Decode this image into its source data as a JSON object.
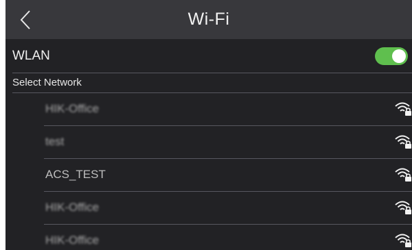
{
  "header": {
    "title": "Wi-Fi",
    "back_icon": "chevron-left-icon"
  },
  "wlan": {
    "label": "WLAN",
    "enabled": true,
    "toggle_color": "#5fbf4e"
  },
  "section": {
    "label": "Select Network"
  },
  "networks": [
    {
      "name": "HIK-Office",
      "obscured": true,
      "icon": "wifi-locked-icon"
    },
    {
      "name": "test",
      "obscured": true,
      "icon": "wifi-locked-icon"
    },
    {
      "name": "ACS_TEST",
      "obscured": false,
      "icon": "wifi-locked-icon"
    },
    {
      "name": "HIK-Office",
      "obscured": true,
      "icon": "wifi-locked-icon"
    },
    {
      "name": "HIK-Office",
      "obscured": true,
      "icon": "wifi-locked-icon"
    }
  ],
  "colors": {
    "background": "#222225",
    "header": "#38383c",
    "text": "#f0f0f0"
  }
}
